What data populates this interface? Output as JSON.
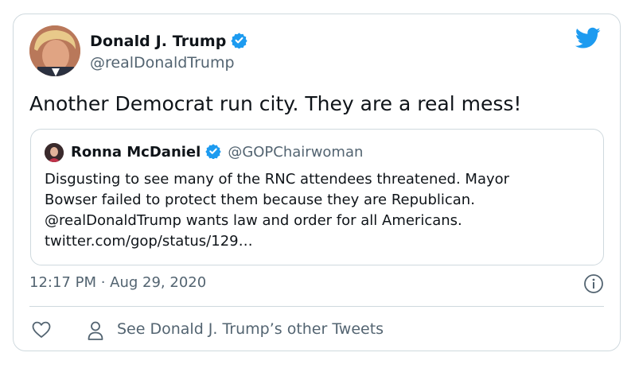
{
  "tweet": {
    "author_name": "Donald J. Trump",
    "author_handle": "@realDonaldTrump",
    "text": "Another Democrat run city. They are a real mess!",
    "timestamp": "12:17 PM · Aug 29, 2020",
    "other_tweets_label": "See Donald J. Trump’s other Tweets"
  },
  "quote": {
    "author_name": "Ronna McDaniel",
    "author_handle": "@GOPChairwoman",
    "lines": [
      "Disgusting to see many of the RNC attendees threatened. Mayor",
      "Bowser failed to protect them because they are Republican.",
      "@realDonaldTrump wants law and order for all Americans.",
      "twitter.com/gop/status/129…"
    ]
  },
  "icons": {
    "verified": "verified-badge-icon",
    "brand": "twitter-bird-icon",
    "info": "info-icon",
    "like": "heart-icon",
    "profile": "person-icon"
  },
  "colors": {
    "brand_blue": "#1d9bf0",
    "text": "#0f1419",
    "secondary_text": "#536471",
    "border": "#cfd9de"
  }
}
